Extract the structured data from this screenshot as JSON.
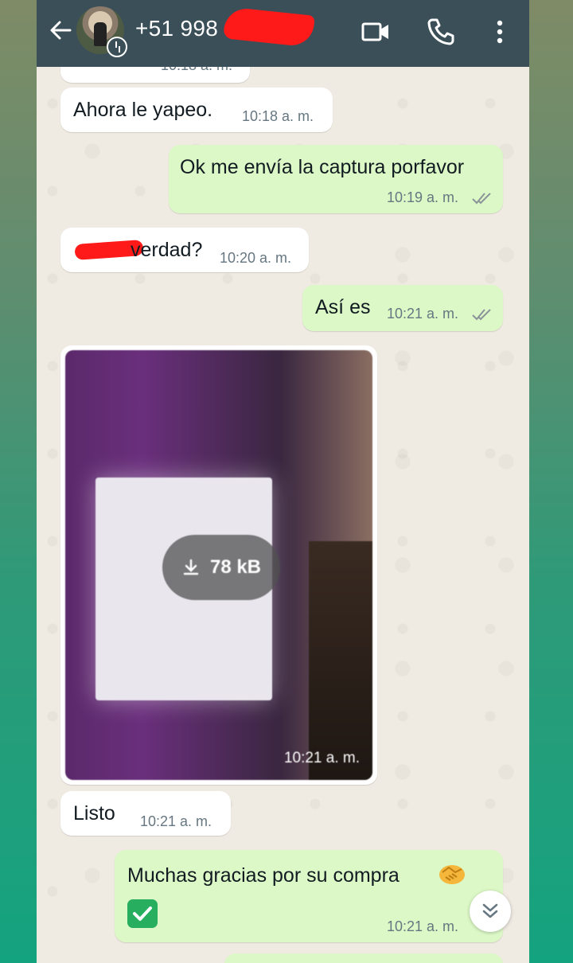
{
  "header": {
    "contact": "+51 998",
    "colors": {
      "bar": "#3a4f58",
      "redaction": "#ff1a1a"
    },
    "icons": [
      "back-arrow-icon",
      "video-call-icon",
      "phone-call-icon",
      "more-vert-icon"
    ]
  },
  "messages": [
    {
      "dir": "in",
      "text": "Ahora le yapeo.",
      "time": "10:18 a. m."
    },
    {
      "dir": "out",
      "text": "Ok me envía la captura porfavor",
      "time": "10:19 a. m.",
      "status": "read"
    },
    {
      "dir": "in",
      "text": "verdad?",
      "time": "10:20 a. m.",
      "partially_redacted": true
    },
    {
      "dir": "out",
      "text": "Así es",
      "time": "10:21 a. m.",
      "status": "read"
    },
    {
      "dir": "in",
      "type": "image",
      "download_size": "78 kB",
      "time": "10:21 a. m."
    },
    {
      "dir": "in",
      "text": "Listo",
      "time": "10:21 a. m."
    },
    {
      "dir": "out",
      "text": "Muchas gracias por su compra",
      "time": "10:21 a. m.",
      "emojis": [
        "handshake",
        "check-mark"
      ]
    }
  ],
  "partial_top_time": "10:18 a. m.",
  "colors": {
    "incoming": "#ffffff",
    "outgoing": "#dcf8c6",
    "background": "#efeae2"
  }
}
